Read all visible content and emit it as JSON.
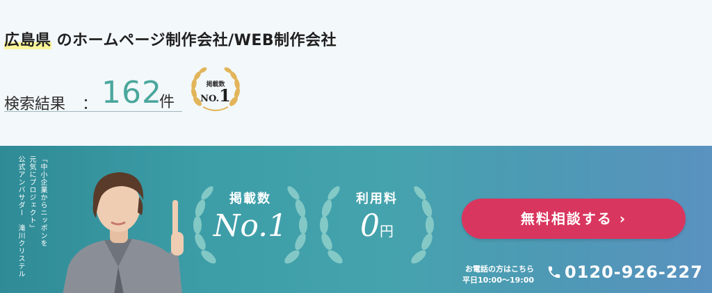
{
  "header": {
    "title_highlight": "広島県",
    "title_rest": " のホームページ制作会社/WEB制作会社",
    "results_label": "検索結果",
    "results_colon": "：",
    "results_count": "162",
    "results_unit": "件",
    "badge": {
      "top": "掲載数",
      "no": "NO.",
      "one": "1"
    }
  },
  "banner": {
    "vertical_text": [
      "「中小企業からニッポンを",
      "元気にプロジェクト」",
      "公式アンバサダー　滝川クリステル"
    ],
    "laurel1": {
      "label": "掲載数",
      "value": "No.1"
    },
    "laurel2": {
      "label": "利用料",
      "value": "0",
      "unit": "円"
    },
    "cta_label": "無料相談する",
    "cta_chevron": "›",
    "phone_note_line1": "お電話の方はこちら",
    "phone_note_line2": "平日10:00～19:00",
    "phone_number": "0120-926-227"
  },
  "colors": {
    "accent": "#4aa79d",
    "cta": "#d9365f",
    "highlight": "#fbf59a",
    "banner": "#3d9ea8"
  }
}
